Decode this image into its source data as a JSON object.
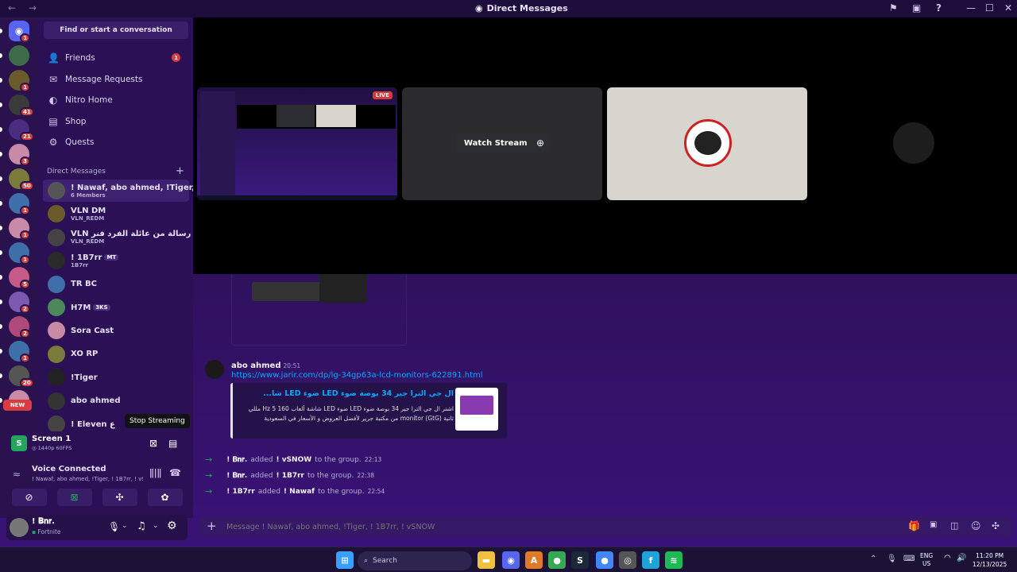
{
  "window": {
    "title": "Direct Messages",
    "nav": "← →"
  },
  "titlebar_icons": {
    "inbox": "⚑",
    "monitor": "▣",
    "help": "?",
    "min": "—",
    "max": "☐",
    "close": "✕"
  },
  "guilds": [
    {
      "badge": "1",
      "color": "#5865f2",
      "glyph": "◉"
    },
    {
      "badge": "",
      "color": "#3d6b4a",
      "glyph": ""
    },
    {
      "badge": "1",
      "color": "#6b5a2a",
      "glyph": ""
    },
    {
      "badge": "41",
      "color": "#3b3b3b",
      "glyph": ""
    },
    {
      "badge": "21",
      "color": "#4a2c80",
      "glyph": ""
    },
    {
      "badge": "3",
      "color": "#c98aa8",
      "glyph": ""
    },
    {
      "badge": "50",
      "color": "#7a7a3a",
      "glyph": ""
    },
    {
      "badge": "1",
      "color": "#3f6fa8",
      "glyph": ""
    },
    {
      "badge": "1",
      "color": "#c98aa8",
      "glyph": ""
    },
    {
      "badge": "1",
      "color": "#3f6fa8",
      "glyph": ""
    },
    {
      "badge": "5",
      "color": "#c85a8a",
      "glyph": ""
    },
    {
      "badge": "2",
      "color": "#7c5ab0",
      "glyph": ""
    },
    {
      "badge": "2",
      "color": "#b04a7a",
      "glyph": ""
    },
    {
      "badge": "1",
      "color": "#3f6fa8",
      "glyph": ""
    },
    {
      "badge": "20",
      "color": "#555",
      "glyph": ""
    },
    {
      "badge": "NEW",
      "color": "#c98aa8",
      "glyph": ""
    }
  ],
  "sidebar": {
    "search_label": "Find or start a conversation",
    "nav": [
      {
        "label": "Friends",
        "icon": "friends-icon",
        "glyph": "👤",
        "badge": "1"
      },
      {
        "label": "Message Requests",
        "icon": "mail-icon",
        "glyph": "✉",
        "badge": ""
      },
      {
        "label": "Nitro Home",
        "icon": "nitro-icon",
        "glyph": "◐",
        "badge": ""
      },
      {
        "label": "Shop",
        "icon": "shop-icon",
        "glyph": "▤",
        "badge": ""
      },
      {
        "label": "Quests",
        "icon": "quests-icon",
        "glyph": "⚙",
        "badge": ""
      }
    ],
    "dm_header": "Direct Messages",
    "dm_plus": "+",
    "dms": [
      {
        "name": "! Nawaf, abo ahmed, !Tiger, ! ...",
        "sub": "6 Members",
        "tag": "",
        "color": "#555"
      },
      {
        "name": "VLN DM",
        "sub": "VLN_REDM",
        "tag": "",
        "color": "#6b5a2a"
      },
      {
        "name": "VLN رسالة من عائلة الفرد فنر",
        "sub": "VLN_REDM",
        "tag": "",
        "color": "#444"
      },
      {
        "name": "! 1B7rr",
        "sub": "1B7rr",
        "tag": "MT",
        "color": "#2a2a2a"
      },
      {
        "name": "TR BC",
        "sub": "",
        "tag": "",
        "color": "#3f6fa8"
      },
      {
        "name": "H7M",
        "sub": "",
        "tag": "3KS",
        "color": "#4a8a5a"
      },
      {
        "name": "Sora Cast",
        "sub": "",
        "tag": "",
        "color": "#c98aa8"
      },
      {
        "name": "XO RP",
        "sub": "",
        "tag": "",
        "color": "#7a7a3a"
      },
      {
        "name": "!Tiger",
        "sub": "",
        "tag": "",
        "color": "#222"
      },
      {
        "name": "abo ahmed",
        "sub": "",
        "tag": "",
        "color": "#333"
      },
      {
        "name": "! Eleven ﻉ",
        "sub": "",
        "tag": "",
        "color": "#444"
      }
    ]
  },
  "stream": {
    "title": "Screen 1",
    "quality": "1440p 60FPS",
    "tooltip": "Stop Streaming"
  },
  "voice": {
    "status": "Voice Connected",
    "channel": "! Nawaf, abo ahmed, !Tiger, ! 1B7rr, ! vS..."
  },
  "user": {
    "name": "! 𝐁𝐧𝐫.",
    "activity": "Fortnite"
  },
  "call": {
    "live_label": "LIVE",
    "watch_label": "Watch Stream"
  },
  "messages": {
    "author": "abo ahmed",
    "time": "20:51",
    "link": "https://www.jarir.com/dp/lg-34gp63a-lcd-monitors-622891.html",
    "embed_title": "ال جي الترا جير 34 بوصة ضوء LED ضوء LED شا...",
    "embed_desc_1": "اشتر ال جي الترا جير 34 بوصة ضوء LED ضوء LED شاشة ألعاب 160 Hz 5 مللي",
    "embed_desc_2": "ثانية monitor (GtG) من مكتبة جرير لأفضل العروض و الأسعار في السعودية",
    "system": [
      {
        "actor": "! 𝐁𝐧𝐫.",
        "verb": "added",
        "target": "! vSNOW",
        "tail": "to the group.",
        "time": "22:13"
      },
      {
        "actor": "! 𝐁𝐧𝐫.",
        "verb": "added",
        "target": "! 1B7rr",
        "tail": "to the group.",
        "time": "22:38"
      },
      {
        "actor": "! 1B7rr",
        "verb": "added",
        "target": "! Nawaf",
        "tail": "to the group.",
        "time": "22:54"
      }
    ]
  },
  "composer": {
    "placeholder": "Message ! Nawaf, abo ahmed, !Tiger, ! 1B7rr, ! vSNOW",
    "plus": "+"
  },
  "taskbar": {
    "search": "Search",
    "lang_1": "ENG",
    "lang_2": "US",
    "time": "11:20 PM",
    "date": "12/13/2025",
    "apps": [
      {
        "name": "start",
        "color": "#3aa0ff",
        "glyph": "⊞"
      },
      {
        "name": "files",
        "color": "#f0c040",
        "glyph": "▬"
      },
      {
        "name": "discord",
        "color": "#5865f2",
        "glyph": "◉"
      },
      {
        "name": "app-a",
        "color": "#e07a2a",
        "glyph": "A"
      },
      {
        "name": "chrome",
        "color": "#34a853",
        "glyph": "●"
      },
      {
        "name": "steam",
        "color": "#1b2838",
        "glyph": "S"
      },
      {
        "name": "chrome-2",
        "color": "#4285f4",
        "glyph": "●"
      },
      {
        "name": "app-b",
        "color": "#555",
        "glyph": "◎"
      },
      {
        "name": "app-c",
        "color": "#1fa3d8",
        "glyph": "f"
      },
      {
        "name": "spotify",
        "color": "#1db954",
        "glyph": "≋"
      }
    ]
  }
}
